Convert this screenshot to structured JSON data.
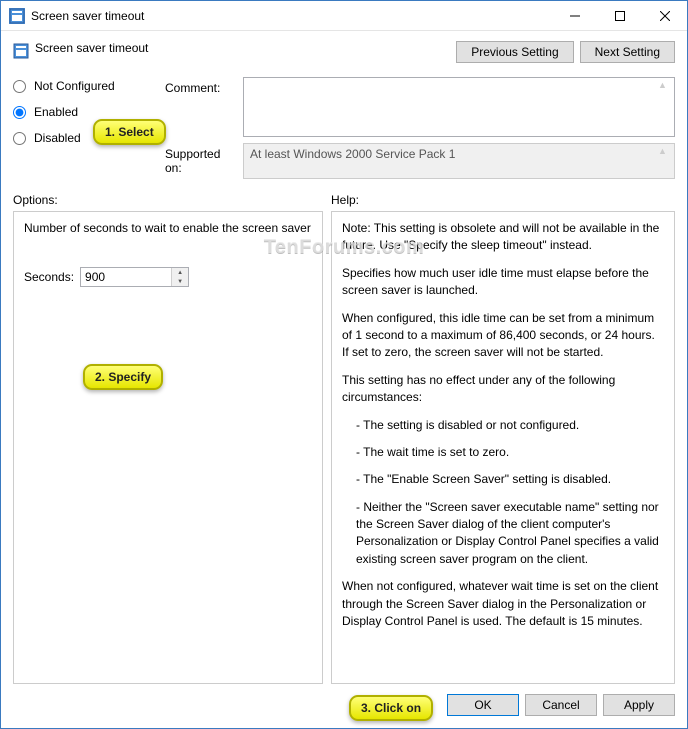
{
  "titlebar": {
    "title": "Screen saver timeout"
  },
  "header": {
    "title": "Screen saver timeout"
  },
  "nav": {
    "previous": "Previous Setting",
    "next": "Next Setting"
  },
  "radios": {
    "not_configured": "Not Configured",
    "enabled": "Enabled",
    "disabled": "Disabled",
    "selected": "enabled"
  },
  "labels": {
    "comment": "Comment:",
    "supported": "Supported on:",
    "options": "Options:",
    "help": "Help:",
    "seconds": "Seconds:"
  },
  "supported_text": "At least Windows 2000 Service Pack 1",
  "options": {
    "description": "Number of seconds to wait to enable the screen saver",
    "seconds_value": "900"
  },
  "help": {
    "p1": "Note: This setting is obsolete and will not be available in the future. Use \"Specify the sleep timeout\" instead.",
    "p2": "Specifies how much user idle time must elapse before the screen saver is launched.",
    "p3": "When configured, this idle time can be set from a minimum of 1 second to a maximum of 86,400 seconds, or 24 hours. If set to zero, the screen saver will not be started.",
    "p4": "This setting has no effect under any of the following circumstances:",
    "b1": "- The setting is disabled or not configured.",
    "b2": "- The wait time is set to zero.",
    "b3": "- The \"Enable Screen Saver\" setting is disabled.",
    "b4": "- Neither the \"Screen saver executable name\" setting nor the Screen Saver dialog of the client computer's Personalization or Display Control Panel specifies a valid existing screen saver program on the client.",
    "p5": "When not configured, whatever wait time is set on the client through the Screen Saver dialog in the Personalization or Display Control Panel is used. The default is 15 minutes."
  },
  "footer": {
    "ok": "OK",
    "cancel": "Cancel",
    "apply": "Apply"
  },
  "callouts": {
    "c1": "1. Select",
    "c2": "2. Specify",
    "c3": "3. Click on"
  },
  "watermark": "TenForums.com"
}
